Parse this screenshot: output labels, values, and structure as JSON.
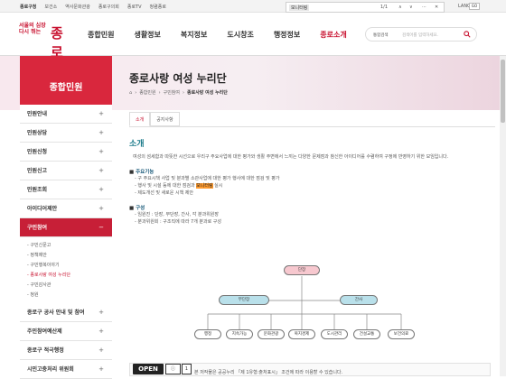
{
  "topbar": {
    "links": [
      "종로구청",
      "보건소",
      "역사문화관광",
      "종로구의회",
      "종로TV",
      "청렴종로"
    ],
    "find_query": "모니터링",
    "find_count": "1/1",
    "lang": "LANG",
    "go": "GO"
  },
  "header": {
    "logo_small": "서울의 심장 다시 뛰는",
    "logo_big": "종로",
    "nav": [
      "종합민원",
      "생활정보",
      "복지정보",
      "도시창조",
      "행정정보",
      "종로소개"
    ],
    "search_scope": "통합검색",
    "search_placeholder": "검색어를 입력하세요."
  },
  "sidebar": {
    "title": "종합민원",
    "items": [
      {
        "label": "민원안내",
        "mark": "+"
      },
      {
        "label": "민원상담",
        "mark": "+"
      },
      {
        "label": "민원신청",
        "mark": "+"
      },
      {
        "label": "민원신고",
        "mark": "+"
      },
      {
        "label": "민원조회",
        "mark": "+"
      },
      {
        "label": "아이디어제안",
        "mark": "+"
      }
    ],
    "open_item": {
      "label": "구민참여",
      "mark": "−"
    },
    "subs": [
      "구민신문고",
      "정책제안",
      "구민행복이야기",
      "종로사랑 여성 누리단",
      "구민감사관",
      "청원"
    ],
    "after_items": [
      {
        "label": "종로구 공사 안내 및 참여",
        "mark": "+"
      },
      {
        "label": "주민참여예산제",
        "mark": "+"
      },
      {
        "label": "종로구 적극행정",
        "mark": "+"
      },
      {
        "label": "시민고충처리 위원회",
        "mark": "+"
      }
    ]
  },
  "page": {
    "title": "종로사랑 여성 누리단",
    "breadcrumb": [
      "종합민원",
      "구민참여",
      "종로사랑 여성 누리단"
    ]
  },
  "tabs": [
    "소개",
    "공지사항"
  ],
  "content": {
    "heading": "소개",
    "intro": "여성의 섬세함과 따뜻한 시선으로 우리구 주요사업에 대한 평가와 생활 주변에서 느끼는 다양한 문제점과 참신한 아이디어를 수렴하여 구정에 반영하기 위한 모임입니다.",
    "s1_title": "주요기능",
    "s1_items": [
      "구 주요시책 사업 및 분과별 소관사업에 대한 평가 행사에 대한 점검 및 평가",
      "행사 및 시설 등에 대한 점검과",
      "제도개선 및 새로운 시책 제안"
    ],
    "s1_hl": "모니터링",
    "s1_tail": "실시",
    "s2_title": "구성",
    "s2_items": [
      "임원진 : 단장, 부단장, 간사, 각 분과위원장",
      "분과위원회 : 구조직에 따라 7개 분과로 구성"
    ]
  },
  "org": {
    "top": "단장",
    "mid": [
      "부단장",
      "간사"
    ],
    "bottom": [
      "행정",
      "지속가능",
      "문화관광",
      "복지경제",
      "도시관리",
      "건설교통",
      "보건의료"
    ]
  },
  "footer": {
    "open": "OPEN",
    "text": "본 저작물은 공공누리 「제 1유형:출처표시」 조건에 따라 이용할 수 있습니다."
  }
}
